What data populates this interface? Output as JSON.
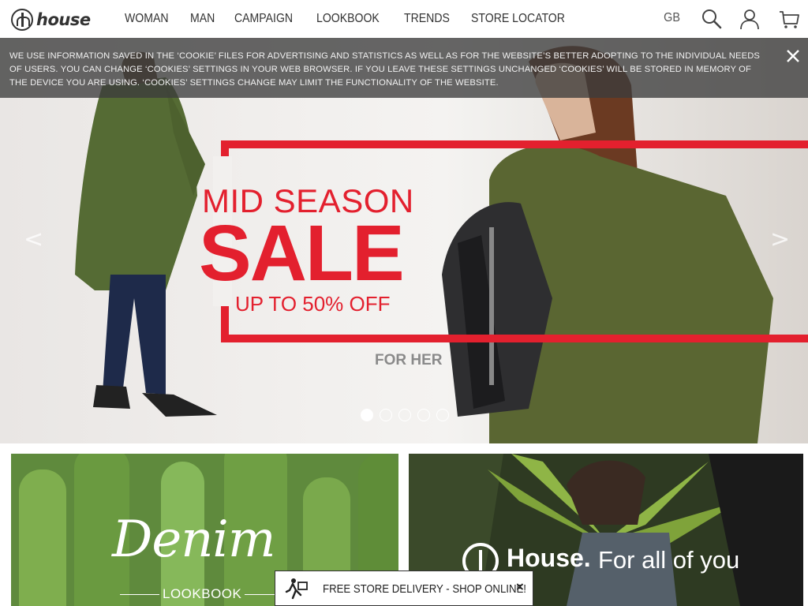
{
  "header": {
    "logo_text": "house",
    "nav": [
      "Woman",
      "Man",
      "Campaign",
      "Lookbook",
      "Trends",
      "Store Locator"
    ],
    "lang": "GB",
    "icons": [
      "search-icon",
      "user-icon",
      "cart-icon"
    ]
  },
  "cookie": {
    "text": "We use information saved in the ‘cookie’ files for advertising and statistics as well as for the website’s better adopting to the individual needs of users. You can change ‘cookies’ settings in your web browser. If you leave these settings unchanged ‘cookies’ will be stored in memory of the device you are using. ‘Cookies’ settings change may limit the functionality of the website.",
    "close_icon": "close-icon"
  },
  "hero": {
    "line1": "MID SEASON",
    "line2": "SALE",
    "line3": "UP TO 50% OFF",
    "sub": "FOR HER",
    "prev_arrow": "<",
    "next_arrow": ">",
    "slides_count": 5,
    "active_slide": 1,
    "accent": "#e3202e"
  },
  "tiles": {
    "denim": {
      "title": "Denim",
      "subtitle": "LOOKBOOK"
    },
    "house": {
      "brand": "House.",
      "tagline": "For all of you"
    }
  },
  "delivery": {
    "text": "Free store delivery - Shop online!",
    "close": "×"
  }
}
